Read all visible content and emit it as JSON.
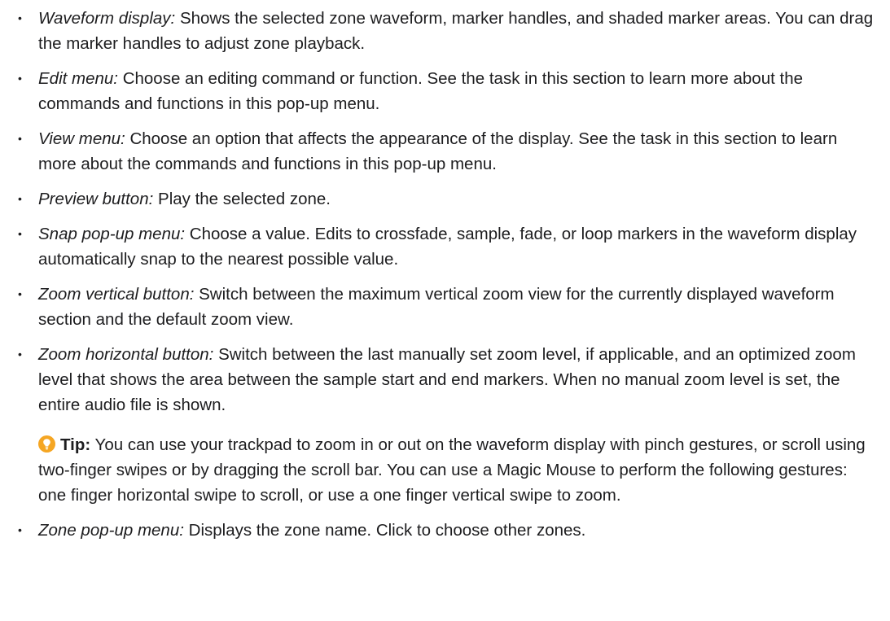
{
  "items": [
    {
      "term": "Waveform display:",
      "text": "Shows the selected zone waveform, marker handles, and shaded marker areas. You can drag the marker handles to adjust zone playback."
    },
    {
      "term": "Edit menu:",
      "text": "Choose an editing command or function. See the task in this section to learn more about the commands and functions in this pop-up menu."
    },
    {
      "term": "View menu:",
      "text": "Choose an option that affects the appearance of the display. See the task in this section to learn more about the commands and functions in this pop-up menu."
    },
    {
      "term": "Preview button:",
      "text": "Play the selected zone."
    },
    {
      "term": "Snap pop-up menu:",
      "text": "Choose a value. Edits to crossfade, sample, fade, or loop markers in the waveform display automatically snap to the nearest possible value."
    },
    {
      "term": "Zoom vertical button:",
      "text": "Switch between the maximum vertical zoom view for the currently displayed waveform section and the default zoom view."
    },
    {
      "term": "Zoom horizontal button:",
      "text": "Switch between the last manually set zoom level, if applicable, and an optimized zoom level that shows the area between the sample start and end markers. When no manual zoom level is set, the entire audio file is shown."
    },
    {
      "term": "Zone pop-up menu:",
      "text": "Displays the zone name. Click to choose other zones."
    }
  ],
  "tip": {
    "icon": "lightbulb-icon",
    "icon_color": "#f5a623",
    "label": "Tip:",
    "text": "You can use your trackpad to zoom in or out on the waveform display with pinch gestures, or scroll using two-finger swipes or by dragging the scroll bar. You can use a Magic Mouse to perform the following gestures: one finger horizontal swipe to scroll, or use a one finger vertical swipe to zoom."
  }
}
